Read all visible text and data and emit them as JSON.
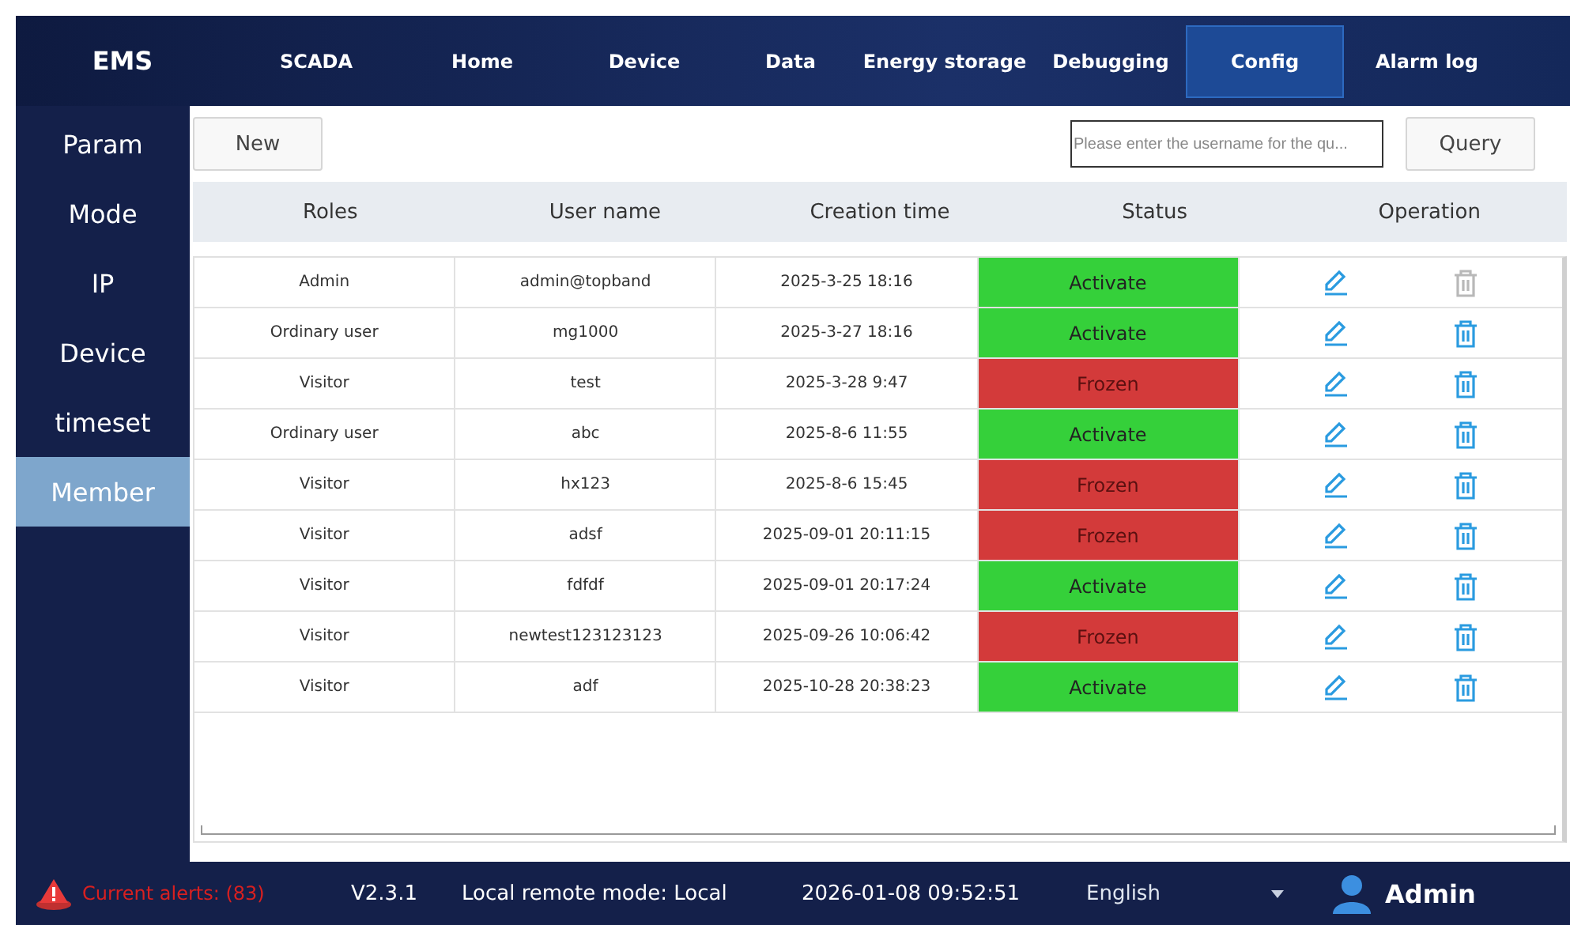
{
  "app": {
    "title": "EMS"
  },
  "nav": [
    {
      "label": "SCADA",
      "selected": false
    },
    {
      "label": "Home",
      "selected": false
    },
    {
      "label": "Device",
      "selected": false
    },
    {
      "label": "Data",
      "selected": false
    },
    {
      "label": "Energy storage",
      "selected": false
    },
    {
      "label": "Debugging",
      "selected": false
    },
    {
      "label": "Config",
      "selected": true
    },
    {
      "label": "Alarm log",
      "selected": false
    }
  ],
  "sidebar": {
    "items": [
      {
        "label": "Param",
        "selected": false
      },
      {
        "label": "Mode",
        "selected": false
      },
      {
        "label": "IP",
        "selected": false
      },
      {
        "label": "Device",
        "selected": false
      },
      {
        "label": "timeset",
        "selected": false
      },
      {
        "label": "Member",
        "selected": true
      }
    ]
  },
  "toolbar": {
    "new_button": "New",
    "search": {
      "placeholder": "Please enter the username for the qu..."
    },
    "query_button": "Query"
  },
  "table": {
    "columns": [
      "Roles",
      "User name",
      "Creation time",
      "Status",
      "Operation"
    ],
    "rows": [
      {
        "role": "Admin",
        "username": "admin@topband",
        "created": "2025-3-25 18:16",
        "status": {
          "kind": "active",
          "label": "Activate"
        },
        "delete_disabled": true
      },
      {
        "role": "Ordinary user",
        "username": "mg1000",
        "created": "2025-3-27 18:16",
        "status": {
          "kind": "active",
          "label": "Activate"
        },
        "delete_disabled": false
      },
      {
        "role": "Visitor",
        "username": "test",
        "created": "2025-3-28 9:47",
        "status": {
          "kind": "frozen",
          "label": "Frozen"
        },
        "delete_disabled": false
      },
      {
        "role": "Ordinary user",
        "username": "abc",
        "created": "2025-8-6 11:55",
        "status": {
          "kind": "active",
          "label": "Activate"
        },
        "delete_disabled": false
      },
      {
        "role": "Visitor",
        "username": "hx123",
        "created": "2025-8-6 15:45",
        "status": {
          "kind": "frozen",
          "label": "Frozen"
        },
        "delete_disabled": false
      },
      {
        "role": "Visitor",
        "username": "adsf",
        "created": "2025-09-01 20:11:15",
        "status": {
          "kind": "frozen",
          "label": "Frozen"
        },
        "delete_disabled": false
      },
      {
        "role": "Visitor",
        "username": "fdfdf",
        "created": "2025-09-01 20:17:24",
        "status": {
          "kind": "active",
          "label": "Activate"
        },
        "delete_disabled": false
      },
      {
        "role": "Visitor",
        "username": "newtest123123123",
        "created": "2025-09-26 10:06:42",
        "status": {
          "kind": "frozen",
          "label": "Frozen"
        },
        "delete_disabled": false
      },
      {
        "role": "Visitor",
        "username": "adf",
        "created": "2025-10-28 20:38:23",
        "status": {
          "kind": "active",
          "label": "Activate"
        },
        "delete_disabled": false
      }
    ]
  },
  "status_bar": {
    "alerts": "Current alerts: (83)",
    "version": "V2.3.1",
    "mode": "Local remote mode: Local",
    "datetime": "2026-01-08 09:52:51",
    "language": "English",
    "user": "Admin"
  }
}
